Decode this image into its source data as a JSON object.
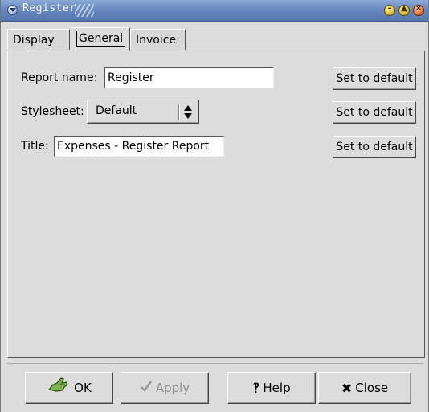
{
  "window": {
    "title": "Register"
  },
  "tabs": [
    {
      "label": "Display"
    },
    {
      "label": "General"
    },
    {
      "label": "Invoice"
    }
  ],
  "general": {
    "report_name_label": "Report name:",
    "report_name_value": "Register",
    "stylesheet_label": "Stylesheet:",
    "stylesheet_value": "Default",
    "title_label": "Title:",
    "title_value": "Expenses - Register Report",
    "set_default_label": "Set to default"
  },
  "buttons": {
    "ok": "OK",
    "apply": "Apply",
    "help": "Help",
    "close": "Close"
  },
  "icons": {
    "ok": "ok-hand-icon",
    "apply": "check-icon",
    "help": "question-icon",
    "close": "x-icon"
  },
  "colors": {
    "titlebar": "#6889bf",
    "background": "#dcdcdc",
    "disabled_text": "#8e8e8e"
  }
}
